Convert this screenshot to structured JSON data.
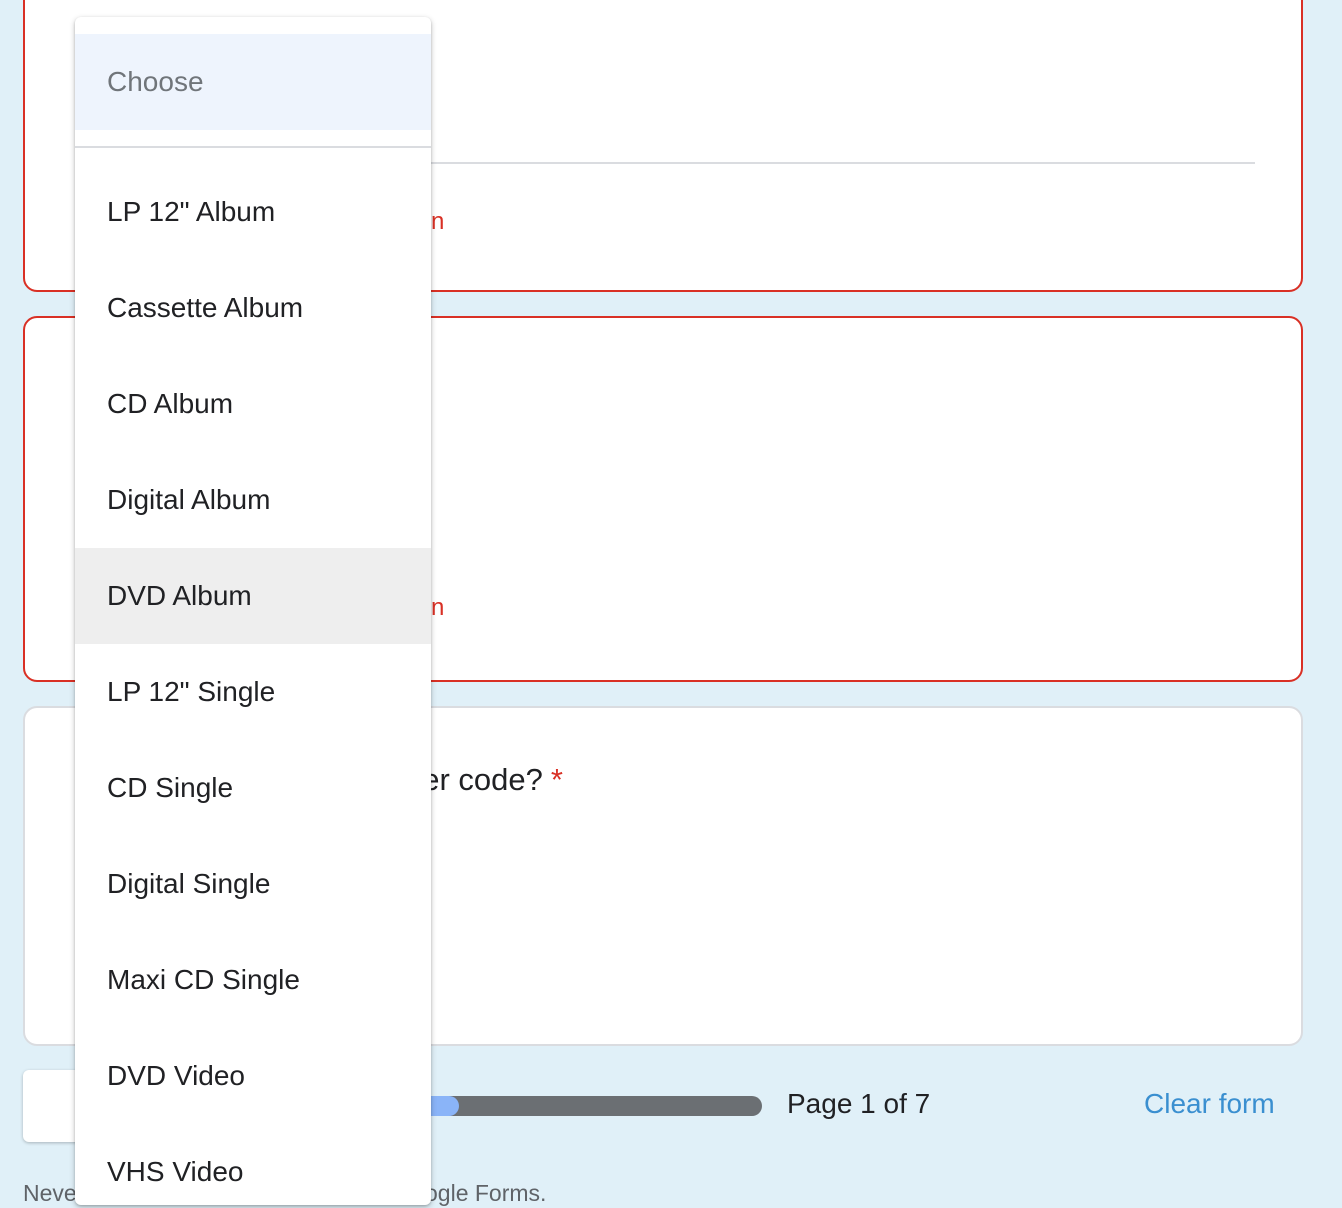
{
  "form": {
    "question_fragment": "her code?",
    "required_mark": "*",
    "error_fragment_1": "n",
    "error_fragment_2": "n"
  },
  "progress": {
    "page_label": "Page 1 of 7",
    "fraction": 0.14
  },
  "actions": {
    "clear_form": "Clear form"
  },
  "footer": {
    "left_fragment": "Neve",
    "right_fragment": "ogle Forms."
  },
  "dropdown": {
    "placeholder": "Choose",
    "highlighted_index": 4,
    "options": [
      "LP 12\" Album",
      "Cassette Album",
      "CD Album",
      "Digital Album",
      "DVD Album",
      "LP 12\" Single",
      "CD Single",
      "Digital Single",
      "Maxi CD Single",
      "DVD Video",
      "VHS Video"
    ]
  },
  "colors": {
    "background": "#e0f0f8",
    "error": "#d93025",
    "accent_link": "#3a8fd0",
    "progress_fill": "#8ab4f8",
    "progress_track": "#6b6f73",
    "highlight": "#eeeeee",
    "placeholder_bg": "#eef4fd"
  }
}
